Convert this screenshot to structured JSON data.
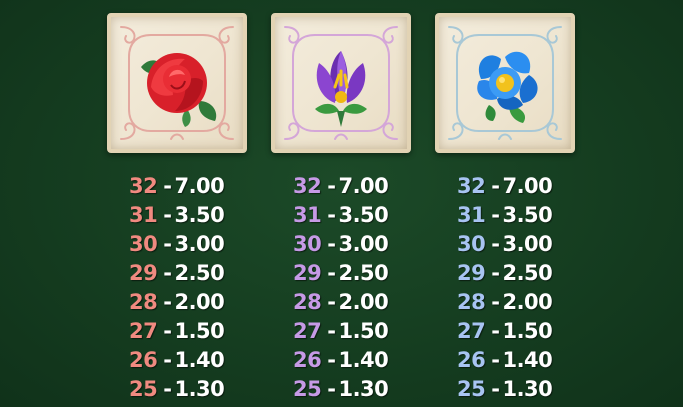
{
  "colors": {
    "background": "#173f22",
    "tile": "#efe6d2",
    "value_text": "#ffffff"
  },
  "symbols": [
    {
      "name": "red-rose",
      "icon": "rose-icon",
      "frame_color": "#e3a9a0",
      "count_color": "#f08a80",
      "payouts": [
        {
          "count": "32",
          "value": "7.00"
        },
        {
          "count": "31",
          "value": "3.50"
        },
        {
          "count": "30",
          "value": "3.00"
        },
        {
          "count": "29",
          "value": "2.50"
        },
        {
          "count": "28",
          "value": "2.00"
        },
        {
          "count": "27",
          "value": "1.50"
        },
        {
          "count": "26",
          "value": "1.40"
        },
        {
          "count": "25",
          "value": "1.30"
        }
      ]
    },
    {
      "name": "purple-crocus",
      "icon": "crocus-icon",
      "frame_color": "#d4a6d8",
      "count_color": "#c69ae6",
      "payouts": [
        {
          "count": "32",
          "value": "7.00"
        },
        {
          "count": "31",
          "value": "3.50"
        },
        {
          "count": "30",
          "value": "3.00"
        },
        {
          "count": "29",
          "value": "2.50"
        },
        {
          "count": "28",
          "value": "2.00"
        },
        {
          "count": "27",
          "value": "1.50"
        },
        {
          "count": "26",
          "value": "1.40"
        },
        {
          "count": "25",
          "value": "1.30"
        }
      ]
    },
    {
      "name": "blue-flower",
      "icon": "blue-flower-icon",
      "frame_color": "#a8c8d6",
      "count_color": "#a8c4f2",
      "payouts": [
        {
          "count": "32",
          "value": "7.00"
        },
        {
          "count": "31",
          "value": "3.50"
        },
        {
          "count": "30",
          "value": "3.00"
        },
        {
          "count": "29",
          "value": "2.50"
        },
        {
          "count": "28",
          "value": "2.00"
        },
        {
          "count": "27",
          "value": "1.50"
        },
        {
          "count": "26",
          "value": "1.40"
        },
        {
          "count": "25",
          "value": "1.30"
        }
      ]
    }
  ]
}
